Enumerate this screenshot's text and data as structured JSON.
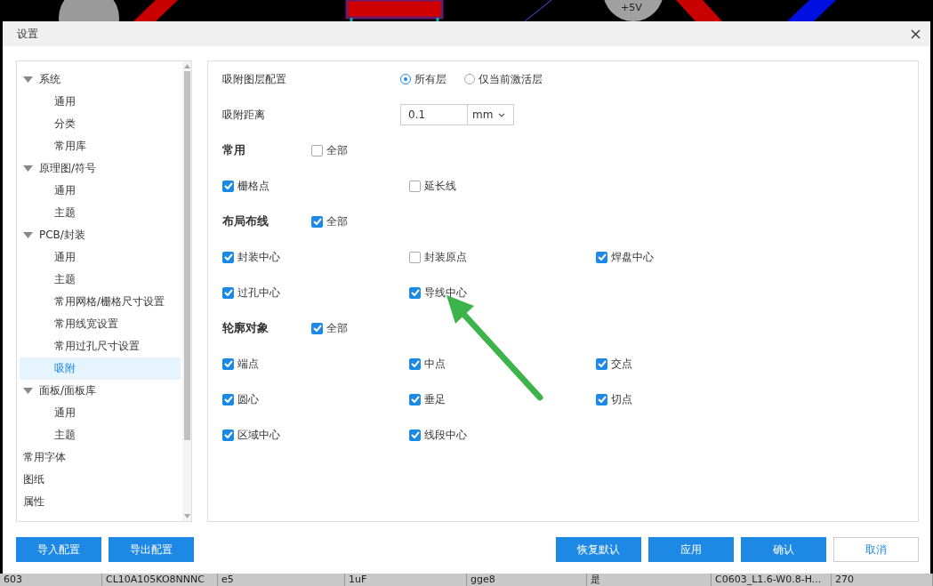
{
  "canvas": {
    "pad_label": "+5V"
  },
  "dialog": {
    "title": "设置",
    "tree": [
      {
        "label": "系统",
        "expanded": true,
        "selected": false,
        "children": [
          {
            "label": "通用",
            "selected": false
          },
          {
            "label": "分类",
            "selected": false
          },
          {
            "label": "常用库",
            "selected": false
          }
        ]
      },
      {
        "label": "原理图/符号",
        "expanded": true,
        "selected": false,
        "children": [
          {
            "label": "通用",
            "selected": false
          },
          {
            "label": "主题",
            "selected": false
          }
        ]
      },
      {
        "label": "PCB/封装",
        "expanded": true,
        "selected": false,
        "children": [
          {
            "label": "通用",
            "selected": false
          },
          {
            "label": "主题",
            "selected": false
          },
          {
            "label": "常用网格/栅格尺寸设置",
            "selected": false
          },
          {
            "label": "常用线宽设置",
            "selected": false
          },
          {
            "label": "常用过孔尺寸设置",
            "selected": false
          },
          {
            "label": "吸附",
            "selected": true
          }
        ]
      },
      {
        "label": "面板/面板库",
        "expanded": true,
        "selected": false,
        "children": [
          {
            "label": "通用",
            "selected": false
          },
          {
            "label": "主题",
            "selected": false
          }
        ]
      },
      {
        "label": "常用字体",
        "selected": false
      },
      {
        "label": "图纸",
        "selected": false
      },
      {
        "label": "属性",
        "selected": false
      }
    ],
    "layer_config": {
      "label": "吸附图层配置",
      "options": [
        {
          "label": "所有层",
          "selected": true
        },
        {
          "label": "仅当前激活层",
          "selected": false
        }
      ]
    },
    "snap_distance": {
      "label": "吸附距离",
      "value": "0.1",
      "unit": "mm"
    },
    "groups": [
      {
        "title": "常用",
        "all_label": "全部",
        "all_checked": false,
        "items": [
          {
            "label": "栅格点",
            "checked": true
          },
          {
            "label": "延长线",
            "checked": false
          }
        ]
      },
      {
        "title": "布局布线",
        "all_label": "全部",
        "all_checked": true,
        "items": [
          {
            "label": "封装中心",
            "checked": true
          },
          {
            "label": "封装原点",
            "checked": false
          },
          {
            "label": "焊盘中心",
            "checked": true
          },
          {
            "label": "过孔中心",
            "checked": true
          },
          {
            "label": "导线中心",
            "checked": true
          }
        ]
      },
      {
        "title": "轮廓对象",
        "all_label": "全部",
        "all_checked": true,
        "items": [
          {
            "label": "端点",
            "checked": true
          },
          {
            "label": "中点",
            "checked": true
          },
          {
            "label": "交点",
            "checked": true
          },
          {
            "label": "圆心",
            "checked": true
          },
          {
            "label": "垂足",
            "checked": true
          },
          {
            "label": "切点",
            "checked": true
          },
          {
            "label": "区域中心",
            "checked": true
          },
          {
            "label": "线段中心",
            "checked": true
          }
        ]
      }
    ],
    "left_buttons": [
      "导入配置",
      "导出配置"
    ],
    "right_buttons": [
      {
        "label": "恢复默认",
        "kind": "primary"
      },
      {
        "label": "应用",
        "kind": "primary"
      },
      {
        "label": "确认",
        "kind": "primary"
      },
      {
        "label": "取消",
        "kind": "secondary"
      }
    ]
  },
  "table_row": [
    "603",
    "CL10A105KO8NNNC",
    "e5",
    "1uF",
    "gge8",
    "是",
    "C0603_L1.6-W0.8-H...",
    "270"
  ]
}
